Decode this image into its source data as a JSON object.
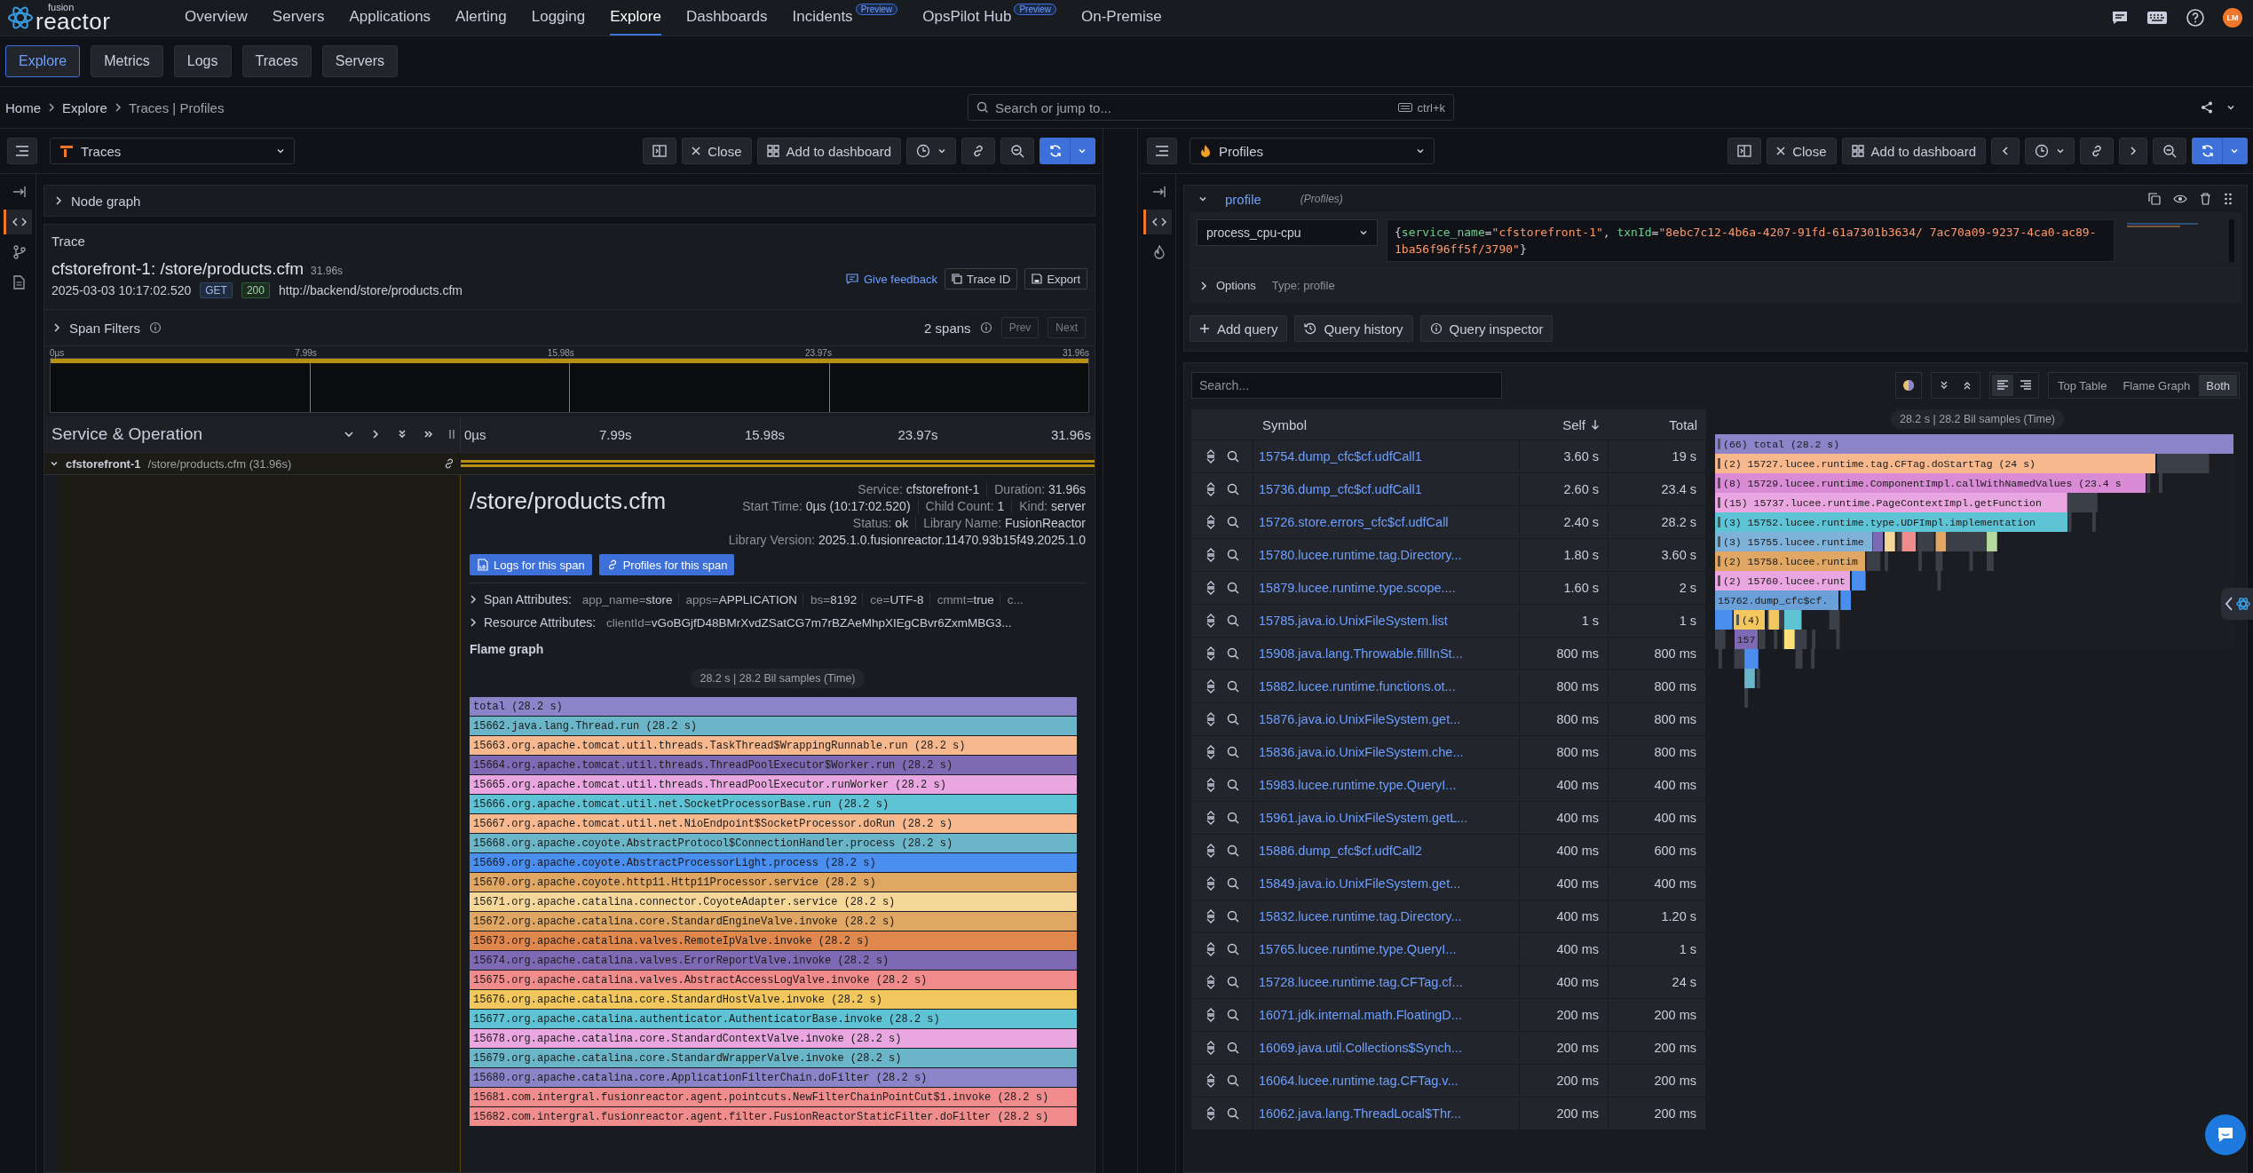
{
  "nav": {
    "logo_top": "fusion",
    "logo_main": "reactor",
    "items": [
      {
        "label": "Overview",
        "selected": false
      },
      {
        "label": "Servers",
        "selected": false
      },
      {
        "label": "Applications",
        "selected": false
      },
      {
        "label": "Alerting",
        "selected": false
      },
      {
        "label": "Logging",
        "selected": false
      },
      {
        "label": "Explore",
        "selected": true
      },
      {
        "label": "Dashboards",
        "selected": false
      },
      {
        "label": "Incidents",
        "selected": false,
        "badge": "Preview"
      },
      {
        "label": "OpsPilot Hub",
        "selected": false,
        "badge": "Preview"
      },
      {
        "label": "On-Premise",
        "selected": false
      }
    ],
    "avatar": "LM"
  },
  "subnav": [
    {
      "label": "Explore",
      "selected": true
    },
    {
      "label": "Metrics",
      "selected": false
    },
    {
      "label": "Logs",
      "selected": false
    },
    {
      "label": "Traces",
      "selected": false
    },
    {
      "label": "Servers",
      "selected": false
    }
  ],
  "breadcrumb": [
    "Home",
    "Explore",
    "Traces | Profiles"
  ],
  "search": {
    "placeholder": "Search or jump to...",
    "shortcut": "ctrl+k"
  },
  "left": {
    "datasource": "Traces",
    "close": "Close",
    "add": "Add to dashboard",
    "rail": [
      {
        "kind": "arrow",
        "selected": false
      },
      {
        "kind": "code",
        "selected": true
      },
      {
        "kind": "branch",
        "selected": false
      },
      {
        "kind": "doc",
        "selected": false
      }
    ],
    "node_graph": "Node graph",
    "trace": {
      "heading": "Trace",
      "title": "cfstorefront-1: /store/products.cfm",
      "duration": "31.96s",
      "date": "2025-03-03 10:17:02.520",
      "method": "GET",
      "status": "200",
      "url": "http://backend/store/products.cfm",
      "feedback": "Give feedback",
      "trace_id": "Trace ID",
      "export": "Export"
    },
    "filters": {
      "label": "Span Filters",
      "count": "2 spans",
      "prev": "Prev",
      "next": "Next"
    },
    "minimap_ticks": [
      "0µs",
      "7.99s",
      "15.98s",
      "23.97s",
      "31.96s"
    ],
    "header": {
      "title": "Service & Operation",
      "ticks": [
        "0µs",
        "7.99s",
        "15.98s",
        "23.97s",
        "31.96s"
      ]
    },
    "span_row": {
      "service": "cfstorefront-1",
      "operation": "/store/products.cfm (31.96s)"
    },
    "span": {
      "title": "/store/products.cfm",
      "meta": [
        [
          {
            "label": "Service:",
            "value": "cfstorefront-1"
          },
          {
            "label": "Duration:",
            "value": "31.96s"
          }
        ],
        [
          {
            "label": "Start Time:",
            "value": "0µs (10:17:02.520)"
          },
          {
            "label": "Child Count:",
            "value": "1"
          },
          {
            "label": "Kind:",
            "value": "server"
          }
        ],
        [
          {
            "label": "Status:",
            "value": "ok"
          },
          {
            "label": "Library Name:",
            "value": "FusionReactor"
          }
        ],
        [
          {
            "label": "Library Version:",
            "value": "2025.1.0.fusionreactor.11470.93b15f49.2025.1.0"
          }
        ]
      ],
      "logs_button": "Logs for this span",
      "profiles_button": "Profiles for this span",
      "span_attributes": {
        "label": "Span Attributes:",
        "items": [
          {
            "key": "app_name",
            "op": "=",
            "value": "store"
          },
          {
            "key": "apps",
            "op": "=",
            "value": "APPLICATION"
          },
          {
            "key": "bs",
            "op": "=",
            "value": "8192"
          },
          {
            "key": "ce",
            "op": "=",
            "value": "UTF-8"
          },
          {
            "key": "cmmt",
            "op": "=",
            "value": "true"
          },
          {
            "key": "c..."
          }
        ]
      },
      "resource_attributes": {
        "label": "Resource Attributes:",
        "items": [
          {
            "key": "clientId",
            "op": "=",
            "value": "vGoBGjfD48BMrXvdZSatCG7m7rBZAeMhpXIEgCBvr6ZxmMBG3..."
          }
        ]
      },
      "flame_title": "Flame graph",
      "flame_summary": "28.2 s | 28.2 Bil samples (Time)",
      "flame": [
        {
          "label": "total (28.2 s)",
          "color": "#8c84c8"
        },
        {
          "label": "15662.java.lang.Thread.run (28.2 s)",
          "color": "#6ab6c8"
        },
        {
          "label": "15663.org.apache.tomcat.util.threads.TaskThread$WrappingRunnable.run (28.2 s)",
          "color": "#f7b88e"
        },
        {
          "label": "15664.org.apache.tomcat.util.threads.ThreadPoolExecutor$Worker.run (28.2 s)",
          "color": "#7e6ab4"
        },
        {
          "label": "15665.org.apache.tomcat.util.threads.ThreadPoolExecutor.runWorker (28.2 s)",
          "color": "#eaa6e0"
        },
        {
          "label": "15666.org.apache.tomcat.util.net.SocketProcessorBase.run (28.2 s)",
          "color": "#5fc3d6"
        },
        {
          "label": "15667.org.apache.tomcat.util.net.NioEndpoint$SocketProcessor.doRun (28.2 s)",
          "color": "#f7b88e"
        },
        {
          "label": "15668.org.apache.coyote.AbstractProtocol$ConnectionHandler.process (28.2 s)",
          "color": "#6ab6c8"
        },
        {
          "label": "15669.org.apache.coyote.AbstractProcessorLight.process (28.2 s)",
          "color": "#4a8ef0"
        },
        {
          "label": "15670.org.apache.coyote.http11.Http11Processor.service (28.2 s)",
          "color": "#e0a764"
        },
        {
          "label": "15671.org.apache.catalina.connector.CoyoteAdapter.service (28.2 s)",
          "color": "#f5d79a"
        },
        {
          "label": "15672.org.apache.catalina.core.StandardEngineValve.invoke (28.2 s)",
          "color": "#e0a764"
        },
        {
          "label": "15673.org.apache.catalina.valves.RemoteIpValve.invoke (28.2 s)",
          "color": "#e0874e"
        },
        {
          "label": "15674.org.apache.catalina.valves.ErrorReportValve.invoke (28.2 s)",
          "color": "#7e6ab4"
        },
        {
          "label": "15675.org.apache.catalina.valves.AbstractAccessLogValve.invoke (28.2 s)",
          "color": "#f08c8c"
        },
        {
          "label": "15676.org.apache.catalina.core.StandardHostValve.invoke (28.2 s)",
          "color": "#f2c85e"
        },
        {
          "label": "15677.org.apache.catalina.authenticator.AuthenticatorBase.invoke (28.2 s)",
          "color": "#5fc3d6"
        },
        {
          "label": "15678.org.apache.catalina.core.StandardContextValve.invoke (28.2 s)",
          "color": "#eaa6e0"
        },
        {
          "label": "15679.org.apache.catalina.core.StandardWrapperValve.invoke (28.2 s)",
          "color": "#6ab6c8"
        },
        {
          "label": "15680.org.apache.catalina.core.ApplicationFilterChain.doFilter (28.2 s)",
          "color": "#8c84c8"
        },
        {
          "label": "15681.com.intergral.fusionreactor.agent.pointcuts.NewFilterChainPointCut$1.invoke (28.2 s)",
          "color": "#f08c8c"
        },
        {
          "label": "15682.com.intergral.fusionreactor.agent.filter.FusionReactorStaticFilter.doFilter (28.2 s)",
          "color": "#f08c8c"
        }
      ]
    }
  },
  "right": {
    "datasource": "Profiles",
    "close": "Close",
    "add": "Add to dashboard",
    "rail": [
      {
        "kind": "arrow",
        "selected": false
      },
      {
        "kind": "code",
        "selected": true
      },
      {
        "kind": "flame",
        "selected": false
      }
    ],
    "query": {
      "name": "profile",
      "source": "(Profiles)",
      "profile_type": "process_cpu-cpu",
      "tokens": [
        {
          "text": "{",
          "kind": "punct"
        },
        {
          "text": "service_name",
          "kind": "key"
        },
        {
          "text": "=",
          "kind": "punct"
        },
        {
          "text": "\"cfstorefront-1\"",
          "kind": "string"
        },
        {
          "text": ", ",
          "kind": "punct"
        },
        {
          "text": "txnId",
          "kind": "key"
        },
        {
          "text": "=",
          "kind": "punct"
        },
        {
          "text": "\"8ebc7c12-4b6a-4207-91fd-61a7301b3634/ 7ac70a09-9237-4ca0-ac89-1ba56f96ff5f/3790\"",
          "kind": "string"
        },
        {
          "text": "}",
          "kind": "punct"
        }
      ],
      "options": "Options",
      "options_type": "Type: profile"
    },
    "buttons": [
      "Add query",
      "Query history",
      "Query inspector"
    ],
    "search": {
      "placeholder": "Search..."
    },
    "views": [
      {
        "label": "Top Table",
        "selected": false
      },
      {
        "label": "Flame Graph",
        "selected": false
      },
      {
        "label": "Both",
        "selected": true
      }
    ],
    "table": {
      "columns": [
        "Symbol",
        "Self",
        "Total"
      ],
      "rows": [
        {
          "symbol": "15754.dump_cfc$cf.udfCall1",
          "self": "3.60 s",
          "total": "19 s"
        },
        {
          "symbol": "15736.dump_cfc$cf.udfCall1",
          "self": "2.60 s",
          "total": "23.4 s"
        },
        {
          "symbol": "15726.store.errors_cfc$cf.udfCall",
          "self": "2.40 s",
          "total": "28.2 s"
        },
        {
          "symbol": "15780.lucee.runtime.tag.Directory...",
          "self": "1.80 s",
          "total": "3.60 s"
        },
        {
          "symbol": "15879.lucee.runtime.type.scope....",
          "self": "1.60 s",
          "total": "2 s"
        },
        {
          "symbol": "15785.java.io.UnixFileSystem.list",
          "self": "1 s",
          "total": "1 s"
        },
        {
          "symbol": "15908.java.lang.Throwable.fillInSt...",
          "self": "800 ms",
          "total": "800 ms"
        },
        {
          "symbol": "15882.lucee.runtime.functions.ot...",
          "self": "800 ms",
          "total": "800 ms"
        },
        {
          "symbol": "15876.java.io.UnixFileSystem.get...",
          "self": "800 ms",
          "total": "800 ms"
        },
        {
          "symbol": "15836.java.io.UnixFileSystem.che...",
          "self": "800 ms",
          "total": "800 ms"
        },
        {
          "symbol": "15983.lucee.runtime.type.QueryI...",
          "self": "400 ms",
          "total": "400 ms"
        },
        {
          "symbol": "15961.java.io.UnixFileSystem.getL...",
          "self": "400 ms",
          "total": "400 ms"
        },
        {
          "symbol": "15886.dump_cfc$cf.udfCall2",
          "self": "400 ms",
          "total": "600 ms"
        },
        {
          "symbol": "15849.java.io.UnixFileSystem.get...",
          "self": "400 ms",
          "total": "400 ms"
        },
        {
          "symbol": "15832.lucee.runtime.tag.Directory...",
          "self": "400 ms",
          "total": "1.20 s"
        },
        {
          "symbol": "15765.lucee.runtime.type.QueryI...",
          "self": "400 ms",
          "total": "1 s"
        },
        {
          "symbol": "15728.lucee.runtime.tag.CFTag.cf...",
          "self": "400 ms",
          "total": "24 s"
        },
        {
          "symbol": "16071.jdk.internal.math.FloatingD...",
          "self": "200 ms",
          "total": "200 ms"
        },
        {
          "symbol": "16069.java.util.Collections$Synch...",
          "self": "200 ms",
          "total": "200 ms"
        },
        {
          "symbol": "16064.lucee.runtime.tag.CFTag.v...",
          "self": "200 ms",
          "total": "200 ms"
        },
        {
          "symbol": "16062.java.lang.ThreadLocal$Thr...",
          "self": "200 ms",
          "total": "200 ms"
        }
      ]
    },
    "flame_summary": "28.2 s | 28.2 Bil samples (Time)",
    "flame": [
      {
        "label": "(66) total (28.2 s)",
        "color": "#8c84c8",
        "level": 1,
        "marker": true
      },
      {
        "label": "(2) 15727.lucee.runtime.tag.CFTag.doStartTag (24 s)",
        "color": "#f7b88e",
        "level": 0.85,
        "marker": true
      },
      {
        "label": "(8) 15729.lucee.runtime.ComponentImpl.callWithNamedValues (23.4 s",
        "color": "#d98bd6",
        "level": 0.83,
        "marker": true
      },
      {
        "label": "(15) 15737.lucee.runtime.PageContextImpl.getFunction",
        "color": "#eaa6e0",
        "level": 0.68,
        "marker": true
      },
      {
        "label": "(3) 15752.lucee.runtime.type.UDFImpl.implementation",
        "color": "#5fc3d6",
        "level": 0.68,
        "marker": true
      },
      {
        "label": "(3) 15755.lucee.runtime",
        "color": "#7fb2d8",
        "level": 0.305,
        "marker": true
      },
      {
        "label": "(2) 15758.lucee.runtim",
        "color": "#e0a764",
        "level": 0.29,
        "marker": true
      },
      {
        "label": "(2) 15760.lucee.runt",
        "color": "#eaa6e0",
        "level": 0.262,
        "marker": true
      },
      {
        "label": "15762.dump_cfc$cf.",
        "color": "#6a9fd8",
        "level": 0.24,
        "marker": false
      },
      {
        "label": "(4)",
        "color": "#f2c85e",
        "level": 0.064,
        "marker": true
      },
      {
        "label": "157",
        "color": "#7e6ab4",
        "level": 0.048,
        "marker": false
      }
    ]
  }
}
